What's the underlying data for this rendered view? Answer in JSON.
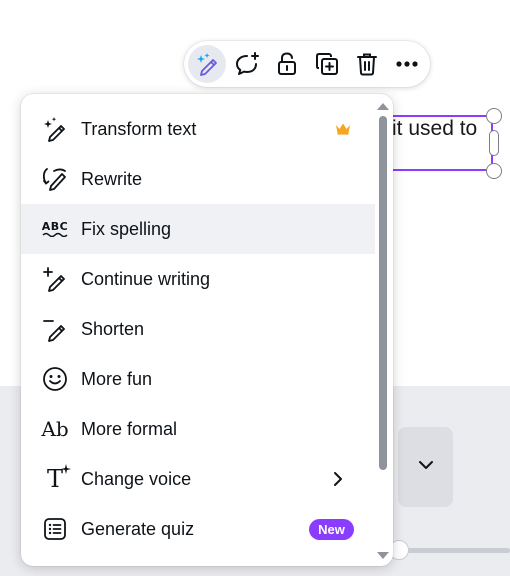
{
  "canvas": {
    "text_fragment": "it used to"
  },
  "toolbar": {
    "buttons": [
      {
        "icon": "magic-pen-icon",
        "active": true
      },
      {
        "icon": "comment-add-icon"
      },
      {
        "icon": "unlock-icon"
      },
      {
        "icon": "duplicate-icon"
      },
      {
        "icon": "trash-icon"
      },
      {
        "icon": "more-icon"
      }
    ]
  },
  "menu": {
    "items": [
      {
        "label": "Transform text",
        "icon": "magic-pen-icon",
        "badge": "crown"
      },
      {
        "label": "Rewrite",
        "icon": "rewrite-icon"
      },
      {
        "label": "Fix spelling",
        "icon": "spellcheck-icon",
        "highlighted": true
      },
      {
        "label": "Continue writing",
        "icon": "continue-writing-icon"
      },
      {
        "label": "Shorten",
        "icon": "shorten-icon"
      },
      {
        "label": "More fun",
        "icon": "smiley-icon"
      },
      {
        "label": "More formal",
        "icon": "formal-text-icon"
      },
      {
        "label": "Change voice",
        "icon": "voice-icon",
        "submenu": true
      },
      {
        "label": "Generate quiz",
        "icon": "quiz-icon",
        "badge": "New"
      }
    ],
    "spell_icon_text": "ABC",
    "formal_icon_text": "Ab",
    "voice_icon_text": "T"
  },
  "colors": {
    "brand_purple": "#8b3dff",
    "crown_gold": "#f5a623",
    "selection_border": "#8b3dff"
  }
}
